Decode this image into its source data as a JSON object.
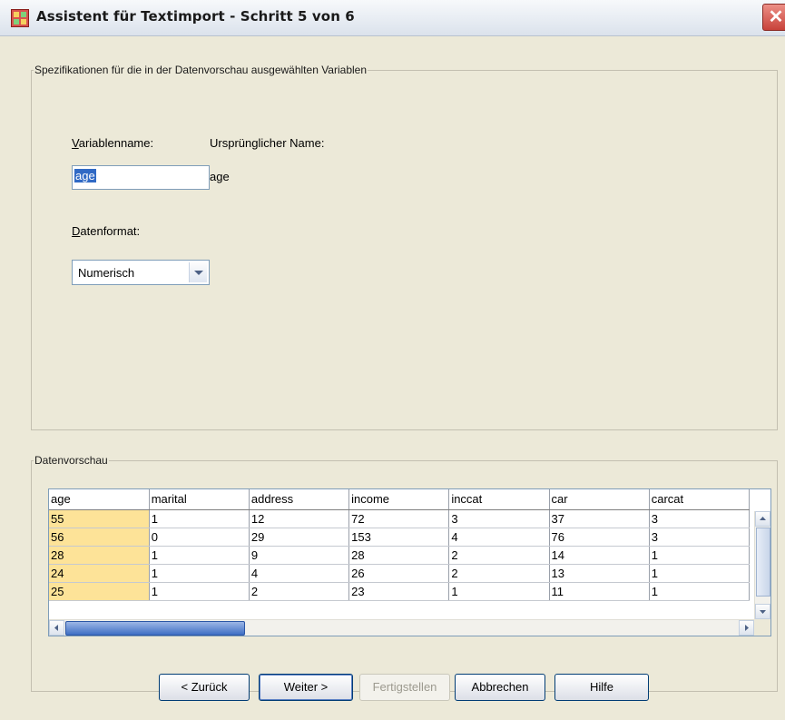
{
  "window": {
    "title": "Assistent für Textimport - Schritt 5 von 6",
    "close_glyph": "✕"
  },
  "specs": {
    "legend": "Spezifikationen für die in der Datenvorschau ausgewählten Variablen",
    "varname_label_first": "V",
    "varname_label_rest": "ariablenname:",
    "original_name_label": "Ursprünglicher Name:",
    "varname_value": "age",
    "original_name_value": "age",
    "format_label_first": "D",
    "format_label_rest": "atenformat:",
    "format_selected": "Numerisch"
  },
  "preview": {
    "legend": "Datenvorschau",
    "columns": [
      "age",
      "marital",
      "address",
      "income",
      "inccat",
      "car",
      "carcat"
    ],
    "rows": [
      [
        "55",
        "1",
        "12",
        "72",
        "3",
        "37",
        "3"
      ],
      [
        "56",
        "0",
        "29",
        "153",
        "4",
        "76",
        "3"
      ],
      [
        "28",
        "1",
        "9",
        "28",
        "2",
        "14",
        "1"
      ],
      [
        "24",
        "1",
        "4",
        "26",
        "2",
        "13",
        "1"
      ],
      [
        "25",
        "1",
        "2",
        "23",
        "1",
        "11",
        "1"
      ]
    ],
    "selected_column": "age"
  },
  "buttons": {
    "back": "< Zurück",
    "next": "Weiter >",
    "finish": "Fertigstellen",
    "cancel": "Abbrechen",
    "help": "Hilfe"
  },
  "colors": {
    "selected_column_bg": "#fde398",
    "close_red": "#c8423a"
  }
}
